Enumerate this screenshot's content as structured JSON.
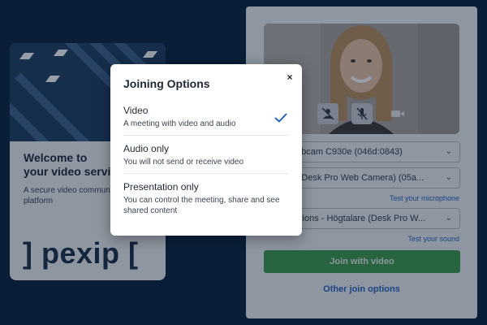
{
  "welcome": {
    "title": "Welcome to\nyour video servic",
    "subtitle": "A secure video commun\nplatform",
    "logo_text": "] pexip ["
  },
  "preview": {
    "controls": [
      "camera-off-icon",
      "microphone-muted-icon",
      "video-camera-icon"
    ]
  },
  "devices": {
    "camera_value": "ech Webcam C930e (046d:0843)",
    "microphone_value": "phone (Desk Pro Web Camera) (05a...",
    "speaker_value": "munications - Högtalare (Desk Pro W..."
  },
  "links": {
    "test_microphone": "Test your microphone",
    "test_sound": "Test your sound",
    "other_join_options": "Other join options"
  },
  "join_button": {
    "label": "Join with video"
  },
  "modal": {
    "title": "Joining Options",
    "close_label": "×",
    "options": [
      {
        "title": "Video",
        "description": "A meeting with video and audio",
        "selected": true
      },
      {
        "title": "Audio only",
        "description": "You will not send or receive video",
        "selected": false
      },
      {
        "title": "Presentation only",
        "description": "You can control the meeting, share and see shared content",
        "selected": false
      }
    ]
  },
  "colors": {
    "page_background": "#0c2340",
    "primary_green": "#3d9b4d",
    "link_blue": "#2c64c0",
    "check_blue": "#2563c9"
  }
}
